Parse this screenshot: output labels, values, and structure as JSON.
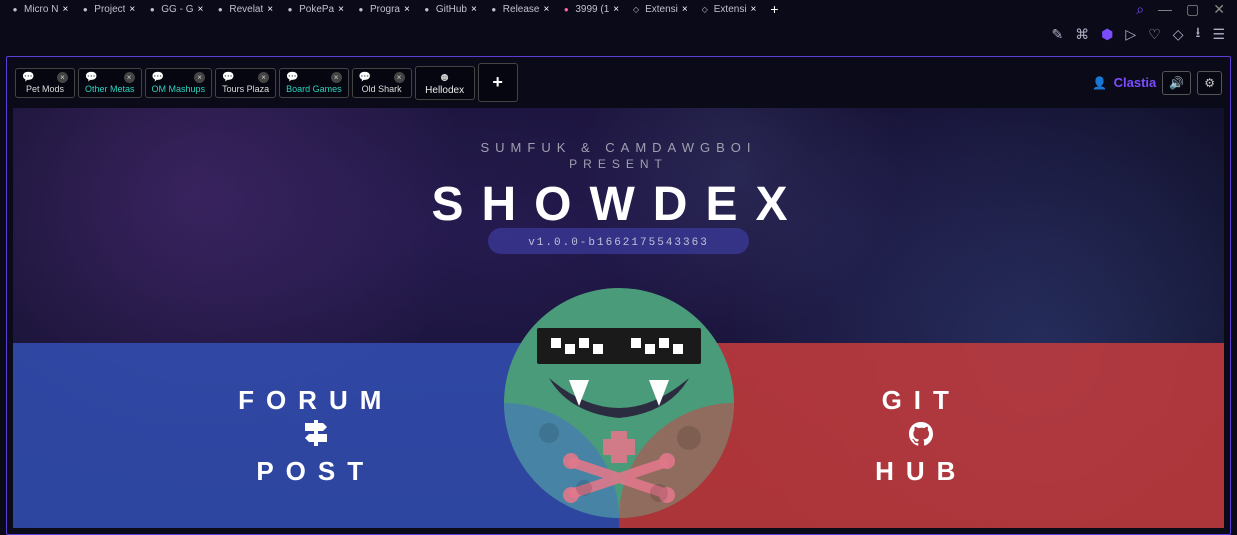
{
  "browser": {
    "tabs": [
      {
        "title": "Micro N"
      },
      {
        "title": "Project"
      },
      {
        "title": "GG - G"
      },
      {
        "title": "Revelat"
      },
      {
        "title": "PokePa"
      },
      {
        "title": "Progra"
      },
      {
        "title": "GitHub"
      },
      {
        "title": "Release"
      },
      {
        "title": "3999 (1"
      },
      {
        "title": "Extensi"
      },
      {
        "title": "Extensi"
      }
    ]
  },
  "app": {
    "tabs": [
      {
        "label": "Pet Mods",
        "style": "default"
      },
      {
        "label": "Other Metas",
        "style": "teal"
      },
      {
        "label": "OM Mashups",
        "style": "teal"
      },
      {
        "label": "Tours Plaza",
        "style": "default"
      },
      {
        "label": "Board Games",
        "style": "teal"
      },
      {
        "label": "Old Shark",
        "style": "default"
      }
    ],
    "hellodex_tab": "Hellodex",
    "username": "Clastia"
  },
  "showdex": {
    "subtitle": "SUMFUK & CAMDAWGBOI",
    "present": "PRESENT",
    "title": "SHOWDEX",
    "version": "v1.0.0-b1662175543363",
    "forum_top": "FORUM",
    "forum_bottom": "POST",
    "git_top": "GIT",
    "git_bottom": "HUB"
  }
}
